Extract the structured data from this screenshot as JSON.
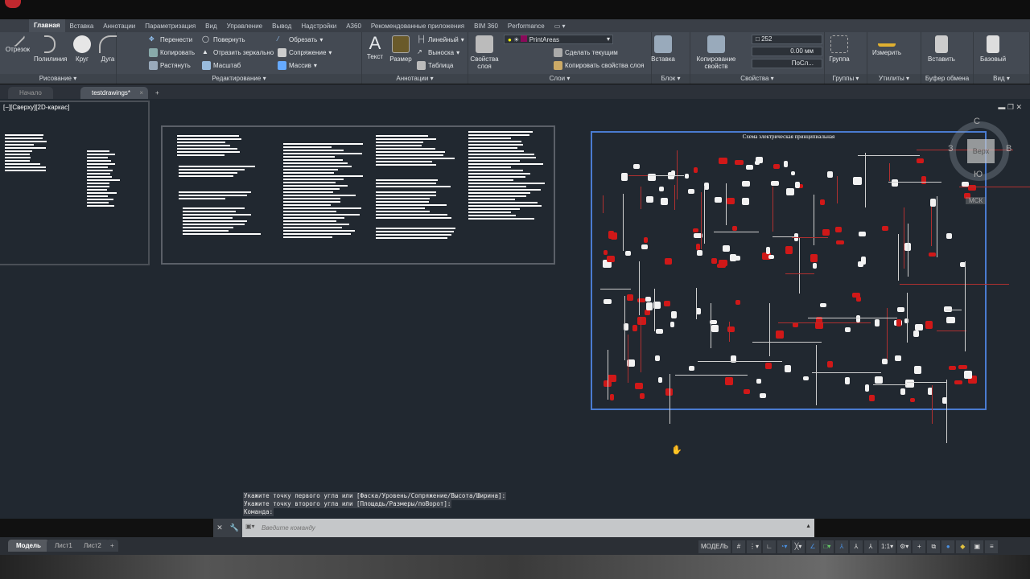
{
  "ribbon_tabs": [
    "Главная",
    "Вставка",
    "Аннотации",
    "Параметризация",
    "Вид",
    "Управление",
    "Вывод",
    "Надстройки",
    "A360",
    "Рекомендованные приложения",
    "BIM 360",
    "Performance"
  ],
  "panels": {
    "draw": {
      "title": "Рисование",
      "items": [
        "Отрезок",
        "Полилиния",
        "Круг",
        "Дуга"
      ]
    },
    "modify": {
      "title": "Редактирование",
      "items": [
        "Перенести",
        "Повернуть",
        "Обрезать",
        "Копировать",
        "Отразить зеркально",
        "Сопряжение",
        "Растянуть",
        "Масштаб",
        "Массив"
      ]
    },
    "annot": {
      "title": "Аннотации",
      "items": [
        "Текст",
        "Размер",
        "Линейный",
        "Выноска",
        "Таблица"
      ]
    },
    "layers": {
      "title": "Слои",
      "layer_props": "Свойства слоя",
      "current_layer": "PrintAreas",
      "make_current": "Сделать текущим",
      "copy_props": "Копировать свойства слоя"
    },
    "block": {
      "title": "Блок",
      "insert": "Вставка"
    },
    "props": {
      "title": "Свойства",
      "match": "Копирование свойств",
      "color": "252",
      "lineweight": "0.00 мм",
      "linetype": "ПоСл..."
    },
    "groups": {
      "title": "Группы",
      "group": "Группа"
    },
    "utils": {
      "title": "Утилиты",
      "measure": "Измерить"
    },
    "clip": {
      "title": "Буфер обмена",
      "paste": "Вставить"
    },
    "view": {
      "title": "Вид",
      "base": "Базовый"
    }
  },
  "doc_tabs": {
    "start": "Начало",
    "drawing": "testdrawings*",
    "close": "×",
    "add": "+"
  },
  "viewport_label": "[−][Сверху][2D-каркас]",
  "viewcube": {
    "top": "Верх",
    "n": "С",
    "w": "З",
    "e": "В",
    "s": "Ю",
    "wcs": "МСК"
  },
  "schematic_title": "Схема электрическая принципиальная",
  "command": {
    "history": [
      "Укажите точку первого угла или [Фаска/Уровень/Сопряжение/Высота/Ширина]:",
      "Укажите точку второго угла или [Площадь/Размеры/поВорот]:",
      "Команда:"
    ],
    "placeholder": "Введите команду"
  },
  "layout_tabs": [
    "Модель",
    "Лист1",
    "Лист2",
    "+"
  ],
  "status": {
    "model": "МОДЕЛЬ",
    "scale": "1:1"
  }
}
